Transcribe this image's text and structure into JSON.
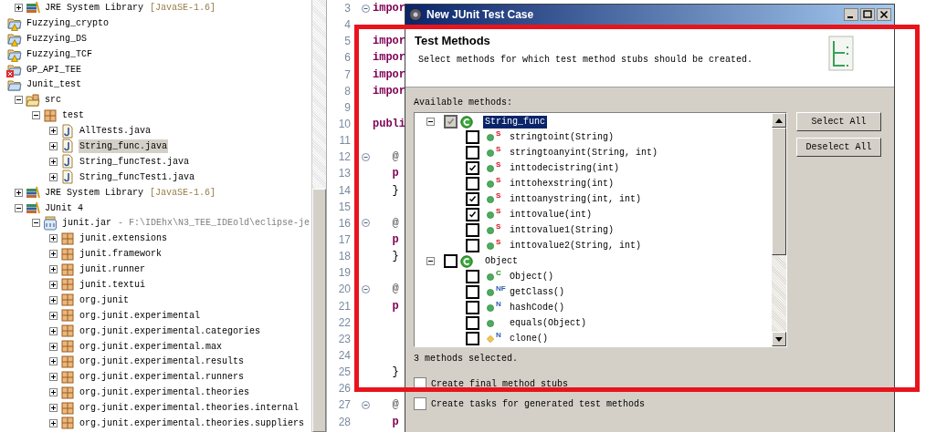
{
  "tree": {
    "continued_items": [
      {
        "label": "JRE System Library",
        "decoration": "[JavaSE-1.6]",
        "kind": "library",
        "expanded": false,
        "selected": false
      }
    ],
    "projects": [
      {
        "label": "Fuzzying_crypto",
        "kind": "project",
        "warning": true,
        "error": false,
        "selected": false
      },
      {
        "label": "Fuzzying_DS",
        "kind": "project",
        "warning": true,
        "error": false,
        "selected": false
      },
      {
        "label": "Fuzzying_TCF",
        "kind": "project",
        "warning": true,
        "error": false,
        "selected": false
      },
      {
        "label": "GP_API_TEE",
        "kind": "project",
        "warning": false,
        "error": true,
        "selected": false
      },
      {
        "label": "Junit_test",
        "kind": "project",
        "selected": false,
        "children": [
          {
            "label": "src",
            "kind": "source-folder",
            "expanded": true,
            "selected": false,
            "children": [
              {
                "label": "test",
                "kind": "package",
                "expanded": true,
                "selected": false,
                "children": [
                  {
                    "label": "AllTests.java",
                    "kind": "java-file",
                    "expanded": false,
                    "selected": false
                  },
                  {
                    "label": "String_func.java",
                    "kind": "java-file",
                    "expanded": false,
                    "selected": true
                  },
                  {
                    "label": "String_funcTest.java",
                    "kind": "java-file",
                    "expanded": false,
                    "selected": false
                  },
                  {
                    "label": "String_funcTest1.java",
                    "kind": "java-file",
                    "expanded": false,
                    "selected": false
                  }
                ]
              }
            ]
          },
          {
            "label": "JRE System Library",
            "decoration": "[JavaSE-1.6]",
            "kind": "library",
            "expanded": false,
            "selected": false
          },
          {
            "label": "JUnit 4",
            "kind": "library",
            "expanded": true,
            "selected": false,
            "children": [
              {
                "label": "junit.jar",
                "decoration": "- F:\\IDEhx\\N3_TEE_IDEold\\eclipse-je",
                "kind": "jar",
                "expanded": true,
                "selected": false,
                "children": [
                  {
                    "label": "junit.extensions",
                    "kind": "package",
                    "expanded": false,
                    "selected": false
                  },
                  {
                    "label": "junit.framework",
                    "kind": "package",
                    "expanded": false,
                    "selected": false
                  },
                  {
                    "label": "junit.runner",
                    "kind": "package",
                    "expanded": false,
                    "selected": false
                  },
                  {
                    "label": "junit.textui",
                    "kind": "package",
                    "expanded": false,
                    "selected": false
                  },
                  {
                    "label": "org.junit",
                    "kind": "package",
                    "expanded": false,
                    "selected": false
                  },
                  {
                    "label": "org.junit.experimental",
                    "kind": "package",
                    "expanded": false,
                    "selected": false
                  },
                  {
                    "label": "org.junit.experimental.categories",
                    "kind": "package",
                    "expanded": false,
                    "selected": false
                  },
                  {
                    "label": "org.junit.experimental.max",
                    "kind": "package",
                    "expanded": false,
                    "selected": false
                  },
                  {
                    "label": "org.junit.experimental.results",
                    "kind": "package",
                    "expanded": false,
                    "selected": false
                  },
                  {
                    "label": "org.junit.experimental.runners",
                    "kind": "package",
                    "expanded": false,
                    "selected": false
                  },
                  {
                    "label": "org.junit.experimental.theories",
                    "kind": "package",
                    "expanded": false,
                    "selected": false
                  },
                  {
                    "label": "org.junit.experimental.theories.internal",
                    "kind": "package",
                    "expanded": false,
                    "selected": false
                  },
                  {
                    "label": "org.junit.experimental.theories.suppliers",
                    "kind": "package",
                    "expanded": false,
                    "selected": false
                  }
                ]
              }
            ]
          }
        ]
      }
    ]
  },
  "editor": {
    "lines": [
      {
        "number": "3",
        "fold": true,
        "text": "impor",
        "kind": "keyword"
      },
      {
        "number": "4"
      },
      {
        "number": "5",
        "text": "impor",
        "kind": "keyword"
      },
      {
        "number": "6",
        "text": "impor",
        "kind": "keyword"
      },
      {
        "number": "7",
        "text": "impor",
        "kind": "keyword"
      },
      {
        "number": "8",
        "text": "impor",
        "kind": "keyword"
      },
      {
        "number": "9"
      },
      {
        "number": "10",
        "text": "publi",
        "kind": "keyword"
      },
      {
        "number": "11"
      },
      {
        "number": "12",
        "fold": true,
        "text": "   @",
        "kind": "annotation"
      },
      {
        "number": "13",
        "text": "   p",
        "kind": "keyword"
      },
      {
        "number": "14",
        "text": "   }",
        "kind": "plain"
      },
      {
        "number": "15"
      },
      {
        "number": "16",
        "fold": true,
        "text": "   @",
        "kind": "annotation"
      },
      {
        "number": "17",
        "text": "   p",
        "kind": "keyword"
      },
      {
        "number": "18",
        "text": "   }",
        "kind": "plain"
      },
      {
        "number": "19"
      },
      {
        "number": "20",
        "fold": true,
        "text": "   @",
        "kind": "annotation"
      },
      {
        "number": "21",
        "text": "   p",
        "kind": "keyword"
      },
      {
        "number": "22"
      },
      {
        "number": "23"
      },
      {
        "number": "24"
      },
      {
        "number": "25",
        "text": "   }",
        "kind": "plain"
      },
      {
        "number": "26"
      },
      {
        "number": "27",
        "fold": true,
        "text": "   @",
        "kind": "annotation"
      },
      {
        "number": "28",
        "text": "   p",
        "kind": "keyword"
      }
    ]
  },
  "dialog": {
    "title": "New JUnit Test Case",
    "header_title": "Test Methods",
    "header_description": "Select methods for which test method stubs should be created.",
    "list_label": "Available methods:",
    "methods": [
      {
        "label": "String_func",
        "kind": "class",
        "checked": true,
        "grayed": true,
        "expanded": true,
        "selected": true,
        "children": [
          {
            "label": "stringtoint(String)",
            "badge": "S",
            "kind": "static",
            "protected": false,
            "checked": false,
            "selected": false
          },
          {
            "label": "stringtoanyint(String, int)",
            "badge": "S",
            "kind": "static",
            "protected": false,
            "checked": false,
            "selected": false
          },
          {
            "label": "inttodecistring(int)",
            "badge": "S",
            "kind": "static",
            "protected": false,
            "checked": true,
            "selected": false
          },
          {
            "label": "inttohexstring(int)",
            "badge": "S",
            "kind": "static",
            "protected": false,
            "checked": false,
            "selected": false
          },
          {
            "label": "inttoanystring(int, int)",
            "badge": "S",
            "kind": "static",
            "protected": false,
            "checked": true,
            "selected": false
          },
          {
            "label": "inttovalue(int)",
            "badge": "S",
            "kind": "static",
            "protected": false,
            "checked": true,
            "selected": false
          },
          {
            "label": "inttovalue1(String)",
            "badge": "S",
            "kind": "static",
            "protected": false,
            "checked": false,
            "selected": false
          },
          {
            "label": "inttovalue2(String, int)",
            "badge": "S",
            "kind": "static",
            "protected": false,
            "checked": false,
            "selected": false
          }
        ]
      },
      {
        "label": "Object",
        "kind": "class",
        "checked": false,
        "grayed": false,
        "expanded": true,
        "selected": false,
        "children": [
          {
            "label": "Object()",
            "badge": "C",
            "kind": "constructor",
            "protected": false,
            "checked": false,
            "selected": false
          },
          {
            "label": "getClass()",
            "badge": "NF",
            "kind": "native",
            "protected": false,
            "checked": false,
            "selected": false
          },
          {
            "label": "hashCode()",
            "badge": "N",
            "kind": "native",
            "protected": false,
            "checked": false,
            "selected": false
          },
          {
            "label": "equals(Object)",
            "kind": "plain",
            "protected": false,
            "checked": false,
            "selected": false
          },
          {
            "label": "clone()",
            "badge": "N",
            "kind": "native",
            "protected": true,
            "checked": false,
            "selected": false
          }
        ]
      }
    ],
    "buttons": [
      "Select All",
      "Deselect All"
    ],
    "status": "3 methods selected.",
    "options": [
      {
        "label": "Create final method stubs",
        "checked": false
      },
      {
        "label": "Create tasks for generated test methods",
        "checked": false
      }
    ]
  }
}
